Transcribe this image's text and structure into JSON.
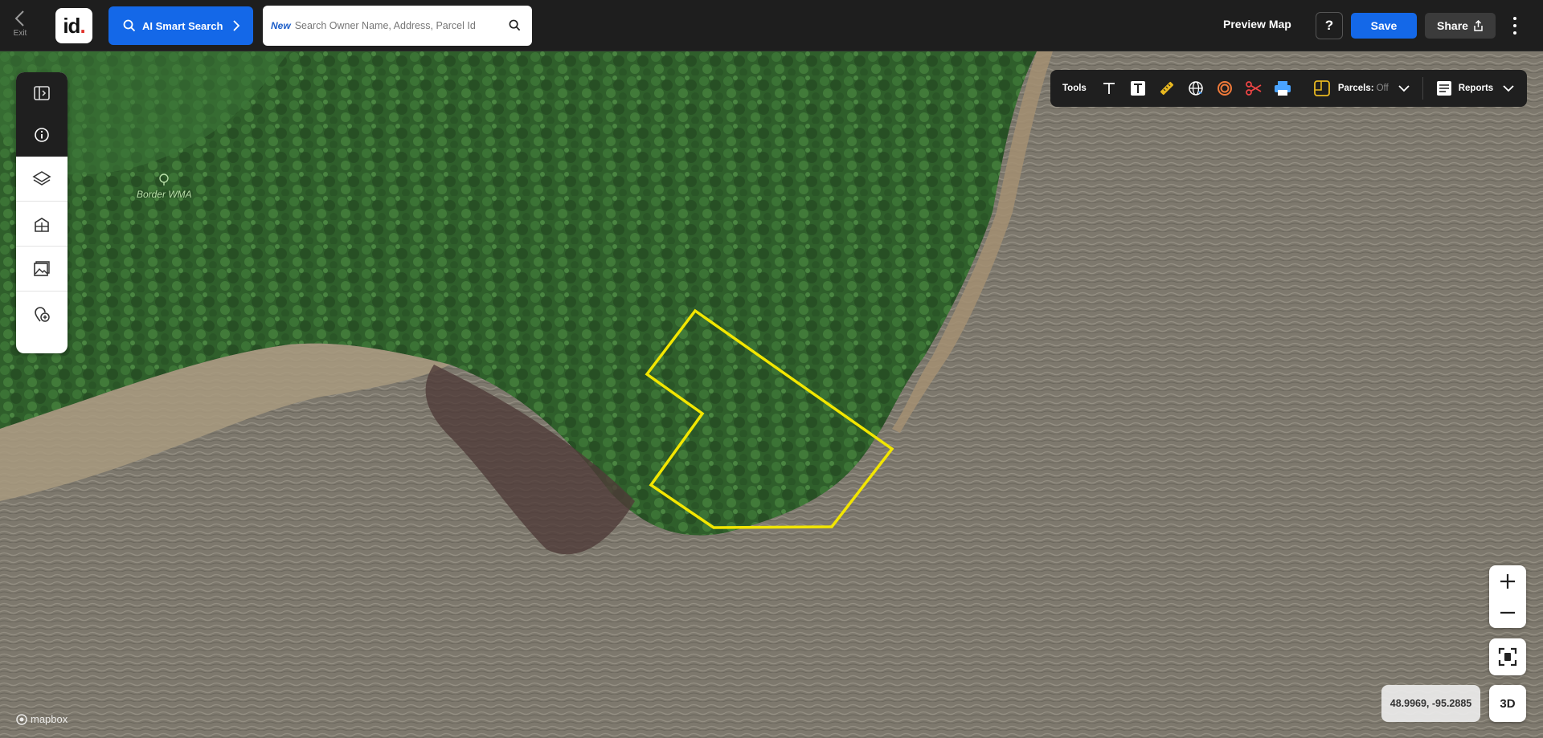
{
  "topbar": {
    "exit_label": "Exit",
    "logo_text": "id",
    "logo_dot": ".",
    "ai_search_label": "AI Smart Search",
    "search_badge": "New",
    "search_placeholder": "Search Owner Name, Address, Parcel Id",
    "preview_label": "Preview Map",
    "help_label": "?",
    "save_label": "Save",
    "share_label": "Share"
  },
  "left_panel": {
    "items": [
      "panel-toggle-icon",
      "info-icon",
      "layers-icon",
      "buildings-icon",
      "imagery-icon",
      "add-location-icon"
    ]
  },
  "toolsbar": {
    "label": "Tools",
    "tools": [
      "text-tool-icon",
      "text-box-tool-icon",
      "ruler-tool-icon",
      "globe-tool-icon",
      "buffer-tool-icon",
      "scissors-tool-icon",
      "print-tool-icon"
    ],
    "parcels_label": "Parcels:",
    "parcels_state": "Off",
    "reports_label": "Reports"
  },
  "map": {
    "poi_label": "Border WMA",
    "coordinates": "48.9969, -95.2885",
    "btn_3d": "3D",
    "attribution": "mapbox",
    "parcel_outline_color": "#f2e600",
    "forest_color": "#2e5e2a",
    "water_color": "#7f7a6e"
  }
}
